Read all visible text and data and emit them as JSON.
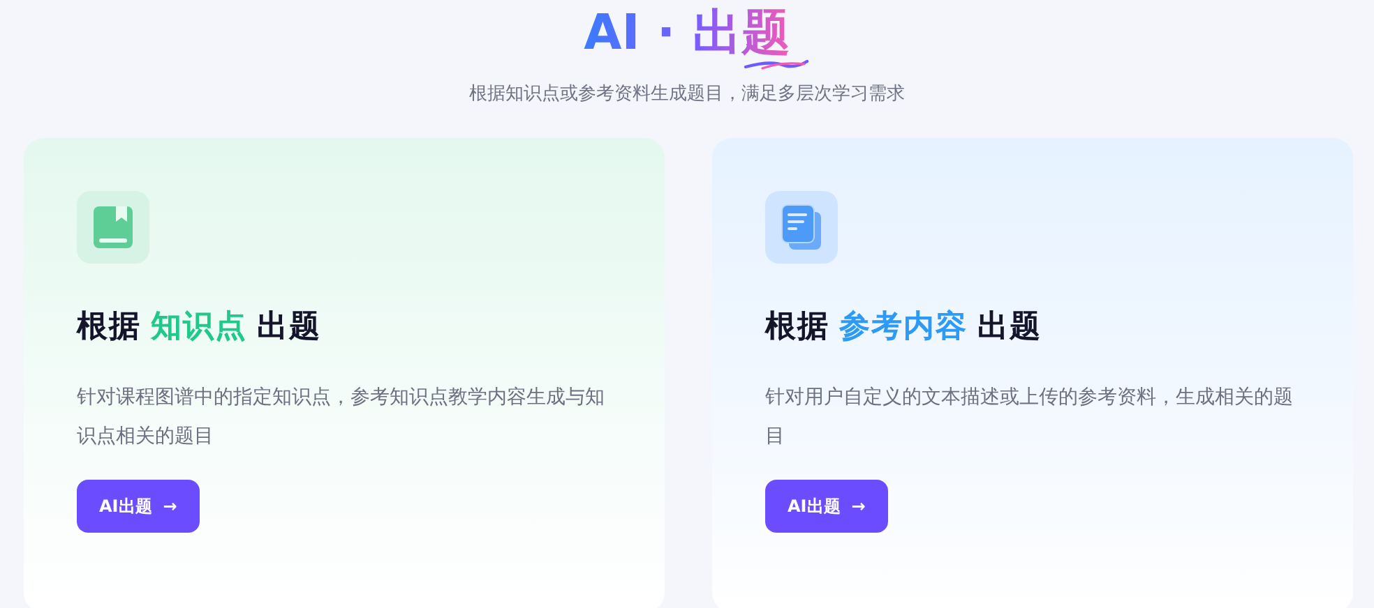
{
  "header": {
    "title": "AI · 出题",
    "subtitle": "根据知识点或参考资料生成题目，满足多层次学习需求"
  },
  "cards": [
    {
      "kind": "book",
      "title_prefix": "根据",
      "title_highlight": "知识点",
      "title_suffix": "出题",
      "color": "#1ec98a",
      "description": "针对课程图谱中的指定知识点，参考知识点教学内容生成与知识点相关的题目",
      "button": {
        "label": "AI出题",
        "icon": "→"
      }
    },
    {
      "kind": "document",
      "title_prefix": "根据",
      "title_highlight": "参考内容",
      "title_suffix": "出题",
      "color": "#2d9bf5",
      "description": "针对用户自定义的文本描述或上传的参考资料，生成相关的题目",
      "button": {
        "label": "AI出题",
        "icon": "→"
      }
    }
  ]
}
